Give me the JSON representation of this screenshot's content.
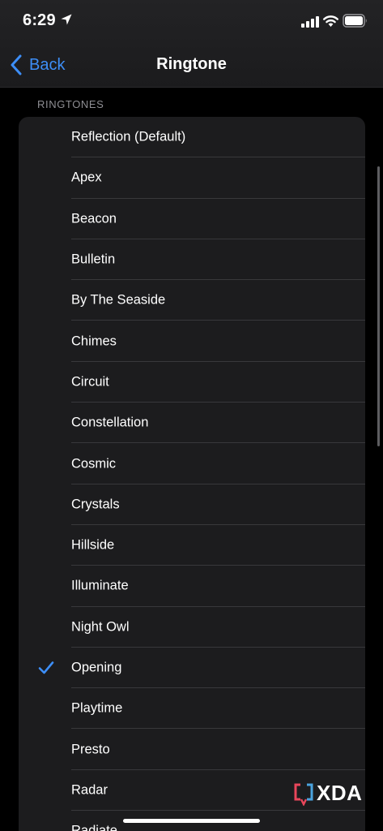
{
  "status_bar": {
    "time": "6:29",
    "location_icon": "location-arrow-icon",
    "signal_icon": "cellular-signal-icon",
    "wifi_icon": "wifi-icon",
    "battery_icon": "battery-icon"
  },
  "nav": {
    "back_label": "Back",
    "title": "Ringtone"
  },
  "section": {
    "header": "RINGTONES",
    "selected": "Opening",
    "items": [
      {
        "label": "Reflection (Default)"
      },
      {
        "label": "Apex"
      },
      {
        "label": "Beacon"
      },
      {
        "label": "Bulletin"
      },
      {
        "label": "By The Seaside"
      },
      {
        "label": "Chimes"
      },
      {
        "label": "Circuit"
      },
      {
        "label": "Constellation"
      },
      {
        "label": "Cosmic"
      },
      {
        "label": "Crystals"
      },
      {
        "label": "Hillside"
      },
      {
        "label": "Illuminate"
      },
      {
        "label": "Night Owl"
      },
      {
        "label": "Opening"
      },
      {
        "label": "Playtime"
      },
      {
        "label": "Presto"
      },
      {
        "label": "Radar"
      },
      {
        "label": "Radiate"
      }
    ]
  },
  "watermark": {
    "text": "XDA"
  },
  "colors": {
    "accent": "#3d8ef7",
    "background": "#000000",
    "group_background": "#1c1c1e",
    "separator": "#38383b",
    "secondary_text": "#8e8e93"
  }
}
